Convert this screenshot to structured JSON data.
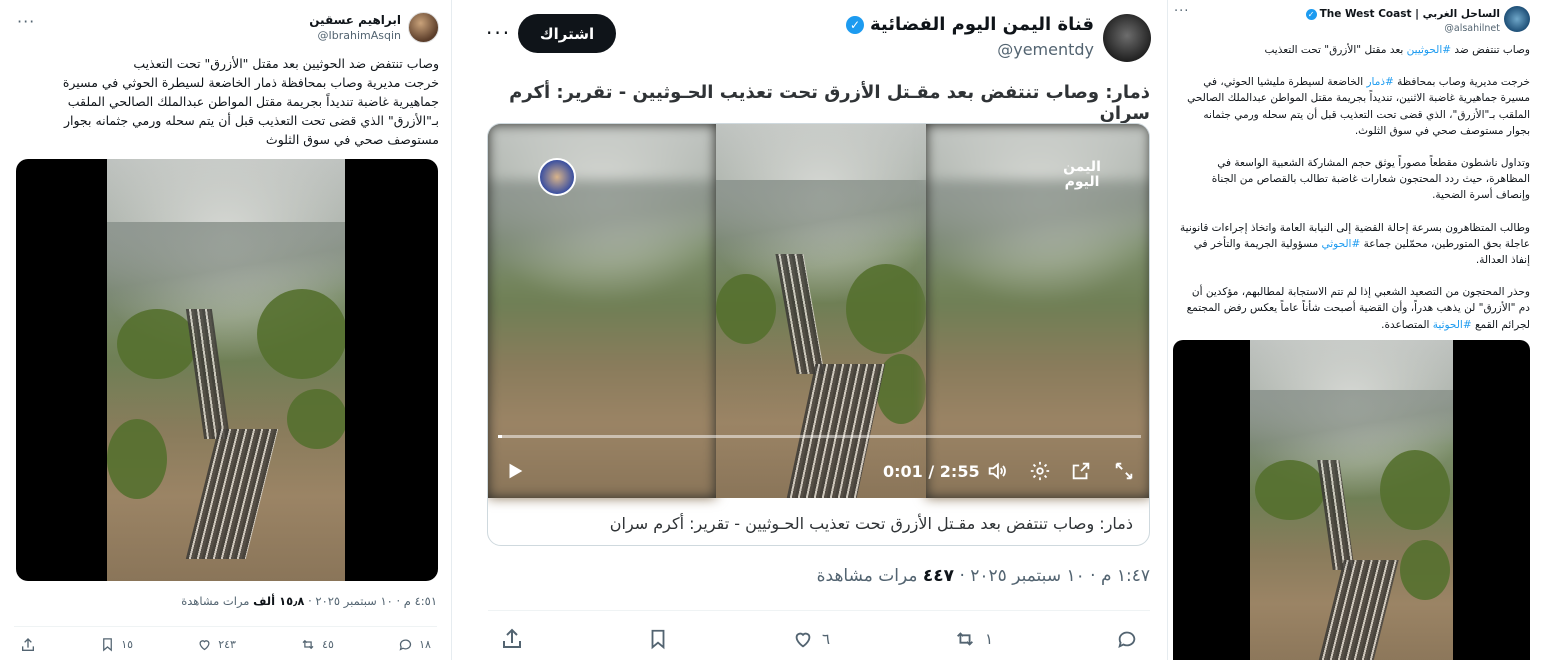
{
  "left_tweet": {
    "author_name": "ابراهيم عسقين",
    "handle": "@IbrahimAsqin",
    "text_lines": [
      "وصاب تنتفض ضد الحوثيين بعد مقتل \"الأزرق\" تحت التعذيب",
      "خرجت مديرية وصاب بمحافظة ذمار الخاضعة لسيطرة الحوثي في مسيرة",
      "جماهيرية غاضبة تنديداً بجريمة مقتل المواطن عبدالملك الصالحي الملقب",
      "بـ\"الأزرق\" الذي قضى تحت التعذيب قبل أن يتم سحله ورمي جثمانه بجوار",
      "مستوصف صحي في سوق الثلوث"
    ],
    "time": "٤:٥١ م · ١٠ سبتمبر ٢٠٢٥ · ",
    "views_count": "١٥٫٨ ألف",
    "views_label": " مرات مشاهدة",
    "replies": "١٨",
    "retweets": "٤٥",
    "likes": "٢٤٣",
    "bookmarks": "١٥"
  },
  "center_tweet": {
    "author_name": "قناة اليمن اليوم الفضائية",
    "handle": "@yementdy",
    "subscribe_label": "اشتراك",
    "headline": "ذمار: وصاب تنتفض بعد مقـتل الأزرق تحت تعذيب الحـوثيين - تقرير: أكرم سران",
    "card_caption": "ذمار: وصاب تنتفض بعد مقـتل الأزرق تحت تعذيب الحـوثيين - تقرير: أكرم سران",
    "video_time": "0:01 / 2:55",
    "video_progress": 0.006,
    "channel_logo_text": "اليمن اليوم",
    "time": "١:٤٧ م · ١٠ سبتمبر ٢٠٢٥ · ",
    "views_count": "٤٤٧",
    "views_label": " مرات مشاهدة",
    "retweets": "١",
    "likes": "٦"
  },
  "right_tweet": {
    "author_name": "الساحل الغربي | The West Coast",
    "handle": "@alsahilnet",
    "p1": "وصاب تنتفض ضد #الحوثيين بعد مقتل \"الأزرق\" تحت التعذيب",
    "p2": "خرجت مديرية وصاب بمحافظة #ذمار الخاضعة لسيطرة مليشيا الحوثي، في مسيرة جماهيرية غاضبة الاثنين، تنديداً بجريمة مقتل المواطن عبدالملك الصالحي الملقب بـ\"الأزرق\"، الذي قضى تحت التعذيب قبل أن يتم سحله ورمي جثمانه بجوار مستوصف صحي في سوق الثلوث.",
    "p3": "وتداول ناشطون مقطعاً مصوراً يوثق حجم المشاركة الشعبية الواسعة في المظاهرة، حيث ردد المحتجون شعارات غاضبة تطالب بالقصاص من الجناة وإنصاف أسرة الضحية.",
    "p4": "وطالب المتظاهرون بسرعة إحالة القضية إلى النيابة العامة واتخاذ إجراءات قانونية عاجلة بحق المتورطين، محمّلين جماعة #الحوثي مسؤولية الجريمة والتأخر في إنفاذ العدالة.",
    "p5": "وحذر المحتجون من التصعيد الشعبي إذا لم تتم الاستجابة لمطالبهم، مؤكدين أن دم \"الأزرق\" لن يذهب هدراً، وأن القضية أصبحت شأناً عاماً يعكس رفض المجتمع لجرائم القمع #الحوثية المتصاعدة."
  },
  "colors": {
    "accent": "#1d9bf0",
    "text": "#0f1419",
    "muted": "#536471"
  }
}
